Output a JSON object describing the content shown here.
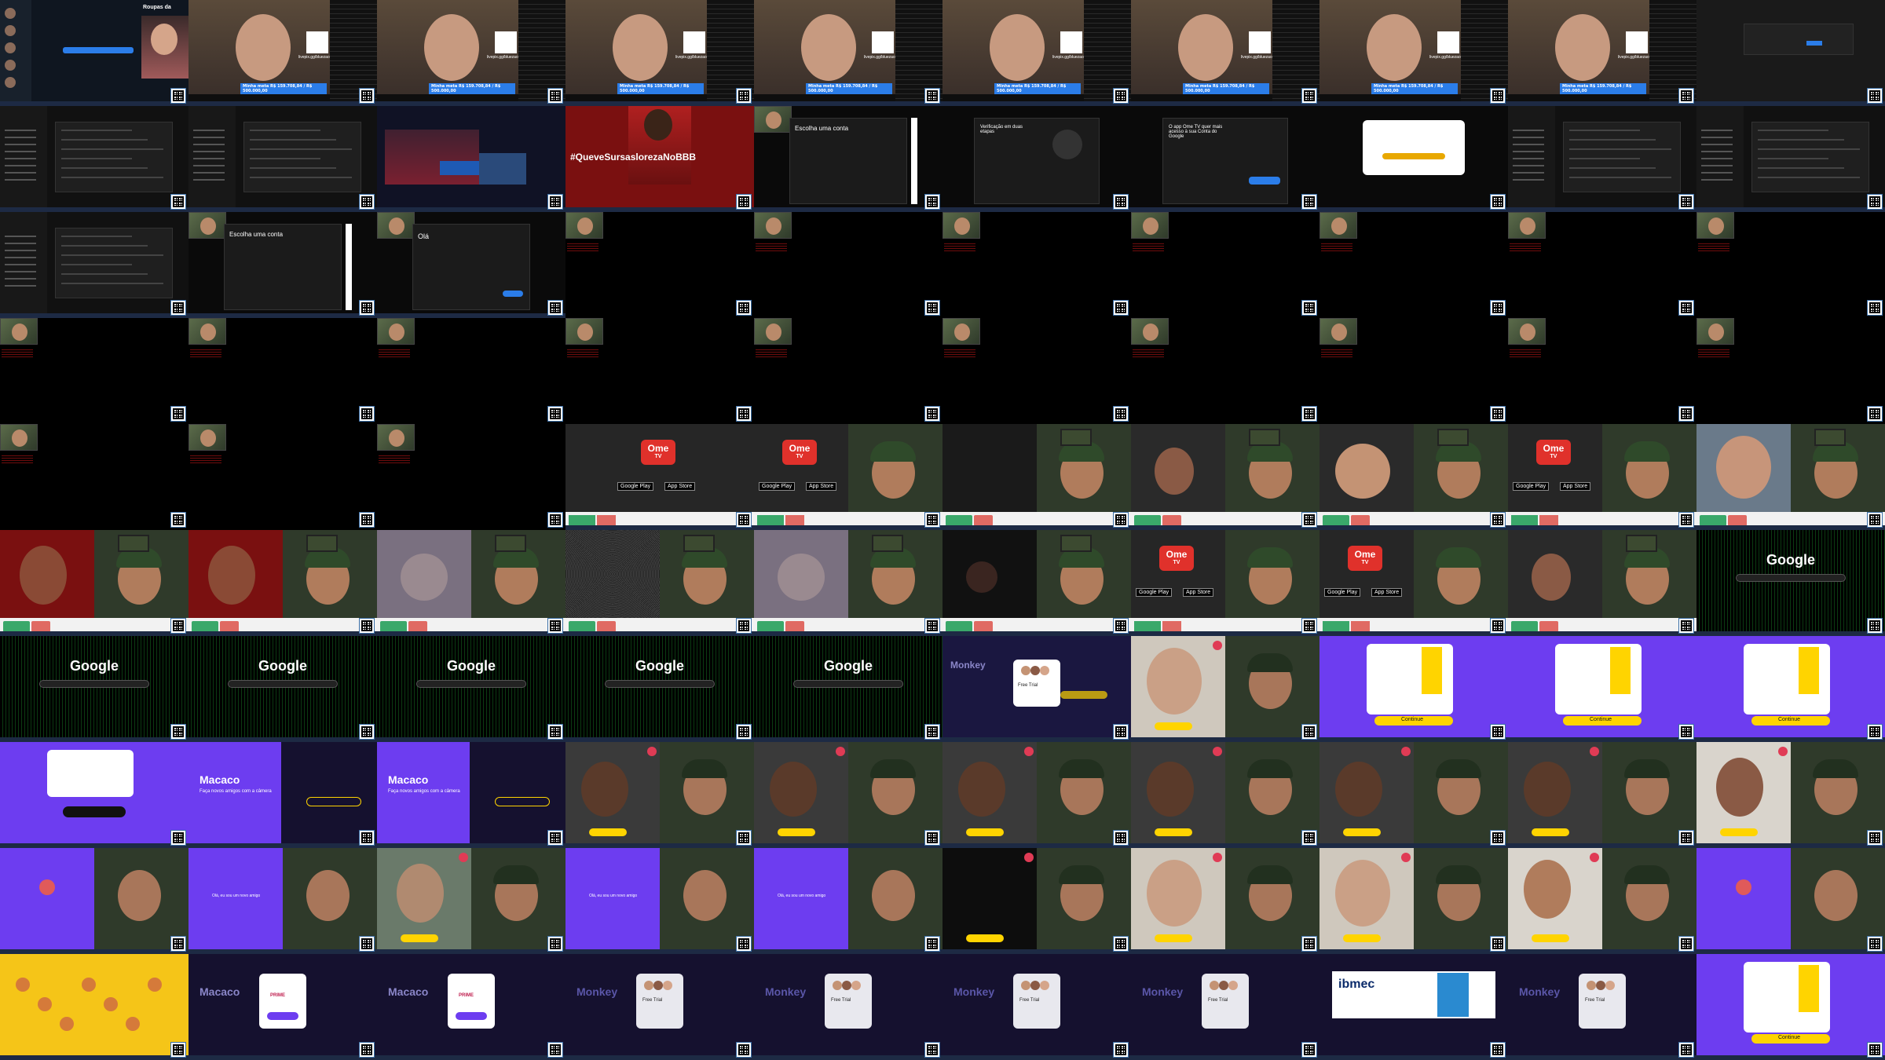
{
  "sheet": {
    "rows": 10,
    "cols": 10
  },
  "colors": {
    "accent_purple": "#6d3df0",
    "accent_yellow": "#ffd400",
    "dark_bg": "#000000",
    "code_green": "#0f8a2a",
    "ometv_red": "#e0312b",
    "qr_border": "#3a6ea5"
  },
  "stream": {
    "overlay_url": "livepix.gg/bluezao",
    "goal_label": "Minha meta R$ 159.708,84 / R$ 500.000,00",
    "chat_title": "Roupas da"
  },
  "dialogs": {
    "choose_account": "Escolha uma conta",
    "age_verification": "Verificação em duas etapas",
    "ometv_access": "O app Ome TV quer mais acesso à sua Conta do Google",
    "ola": "Olá"
  },
  "banners": {
    "hashtag": "#QueveSursaslorezaNoBBB"
  },
  "ometv": {
    "logo_text": "Ome",
    "logo_sub": "TV",
    "google_play": "Google Play",
    "app_store": "App Store"
  },
  "google": {
    "logo": "Google"
  },
  "monkey": {
    "brand_macaco": "Macaco",
    "brand_monkey": "Monkey",
    "tagline": "Faça novos amigos com a câmera",
    "free_trial": "Free Trial",
    "prime_label": "PRIME",
    "continue": "Continue",
    "chat_label": "Olá, eu sou um novo amigo"
  },
  "ads": {
    "ibmec": "ibmec"
  }
}
